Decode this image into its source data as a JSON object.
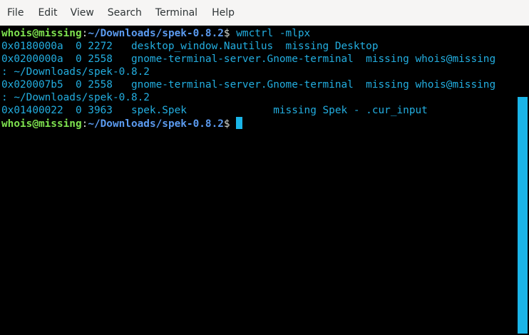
{
  "menubar": {
    "items": [
      {
        "label": "File"
      },
      {
        "label": "Edit"
      },
      {
        "label": "View"
      },
      {
        "label": "Search"
      },
      {
        "label": "Terminal"
      },
      {
        "label": "Help"
      }
    ]
  },
  "terminal": {
    "prompt": {
      "user_host": "whois@missing",
      "separator": ":",
      "path": "~/Downloads/spek-0.8.2",
      "sign": "$ "
    },
    "command": "wmctrl -mlpx",
    "output_lines": [
      "0x0180000a  0 2272   desktop_window.Nautilus  missing Desktop",
      "0x0200000a  0 2558   gnome-terminal-server.Gnome-terminal  missing whois@missing",
      ": ~/Downloads/spek-0.8.2",
      "0x020007b5  0 2558   gnome-terminal-server.Gnome-terminal  missing whois@missing",
      ": ~/Downloads/spek-0.8.2",
      "0x01400022  0 3963   spek.Spek              missing Spek - .cur_input"
    ]
  },
  "colors": {
    "menubar_bg": "#f6f5f4",
    "terminal_bg": "#000000",
    "output_text": "#23aee0",
    "prompt_user": "#7ee24f",
    "prompt_path": "#5b9bf0",
    "cursor": "#1ab5e8",
    "scrollbar": "#1ab5e8"
  }
}
